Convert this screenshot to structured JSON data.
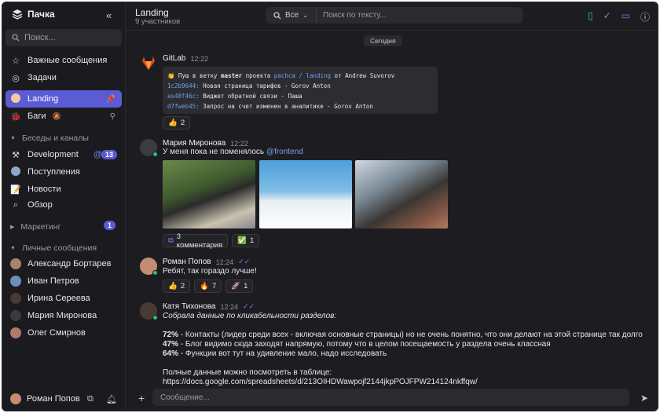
{
  "app": {
    "name": "Пачка"
  },
  "sidebar": {
    "search_placeholder": "Поиск...",
    "top_items": [
      {
        "label": "Важные сообщения",
        "icon": "star-icon"
      },
      {
        "label": "Задачи",
        "icon": "check-circle-icon"
      }
    ],
    "pinned": [
      {
        "label": "Landing",
        "icon": "landing-icon",
        "active": true
      },
      {
        "label": "Баги",
        "icon": "bug-icon"
      }
    ],
    "channels_header": "Беседы и каналы",
    "channels": [
      {
        "label": "Development",
        "icon": "tools-icon",
        "mention": "@",
        "badge": "13"
      },
      {
        "label": "Поступления",
        "icon": "download-icon"
      },
      {
        "label": "Новости",
        "icon": "news-icon"
      },
      {
        "label": "Обзор",
        "icon": "search-icon"
      }
    ],
    "marketing": {
      "label": "Маркетинг",
      "badge": "1"
    },
    "dm_header": "Личные сообщения",
    "dms": [
      {
        "label": "Александр Бортарев"
      },
      {
        "label": "Иван Петров"
      },
      {
        "label": "Ирина Сереева"
      },
      {
        "label": "Мария Миронова"
      },
      {
        "label": "Олег Смирнов"
      }
    ],
    "current_user": "Роман Попов"
  },
  "header": {
    "title": "Landing",
    "subtitle": "9 участников",
    "search_scope": "Все",
    "search_placeholder": "Поиск по тексту..."
  },
  "chat": {
    "date": "Сегодня",
    "messages": [
      {
        "author": "GitLab",
        "time": "12:22",
        "push": {
          "prefix": "👏 Пуш в ветку",
          "branch": "master",
          "mid": "проекта",
          "project": "pachca / landing",
          "suffix": "от Andrew Suvorov"
        },
        "commits": [
          {
            "hash": "1c2b9644:",
            "text": "Новая страница тарифов - Gorov Anton"
          },
          {
            "hash": "as48f46c:",
            "text": "Виджет обратной связи - Паша"
          },
          {
            "hash": "d7fweb45:",
            "text": "Запрос на счет изменен в аналитике - Gorov Anton"
          }
        ],
        "reactions": [
          {
            "emoji": "👍",
            "count": "2"
          }
        ]
      },
      {
        "author": "Мария Миронова",
        "time": "12:22",
        "text": "У меня пока не поменялось",
        "mention": "@frontend",
        "thread": "3 комментария",
        "check_count": "1"
      },
      {
        "author": "Роман Попов",
        "time": "12:24",
        "text": "Ребят, так гораздо лучше!",
        "reactions": [
          {
            "emoji": "👍",
            "count": "2"
          },
          {
            "emoji": "🔥",
            "count": "7"
          },
          {
            "emoji": "🚀",
            "count": "1"
          }
        ]
      },
      {
        "author": "Катя Тихонова",
        "time": "12:24",
        "intro": "Собрала данные по кликабельности разделов:",
        "lines": [
          {
            "pct": "72%",
            "text": " - Контакты (лидер среди всех - включая основные страницы) но не очень понятно, что они делают на этой странице так долго"
          },
          {
            "pct": "47%",
            "text": " - Блог видимо сюда заходят напрямую, потому что в целом посещаемость у раздела очень классная"
          },
          {
            "pct": "64%",
            "text": " - Функции вот тут на удивление мало, надо исследовать"
          }
        ],
        "full": "Полные данные можно посмотреть в таблице:",
        "link": "https://docs.google.com/spreadsheets/d/213OIHDWawpojf2144jkpPOJFPW214124nkffqw/"
      }
    ]
  },
  "composer": {
    "placeholder": "Сообщение..."
  },
  "colors": {
    "accent": "#5b5bd6",
    "bg": "#1d1d21",
    "online": "#2fbf71"
  }
}
